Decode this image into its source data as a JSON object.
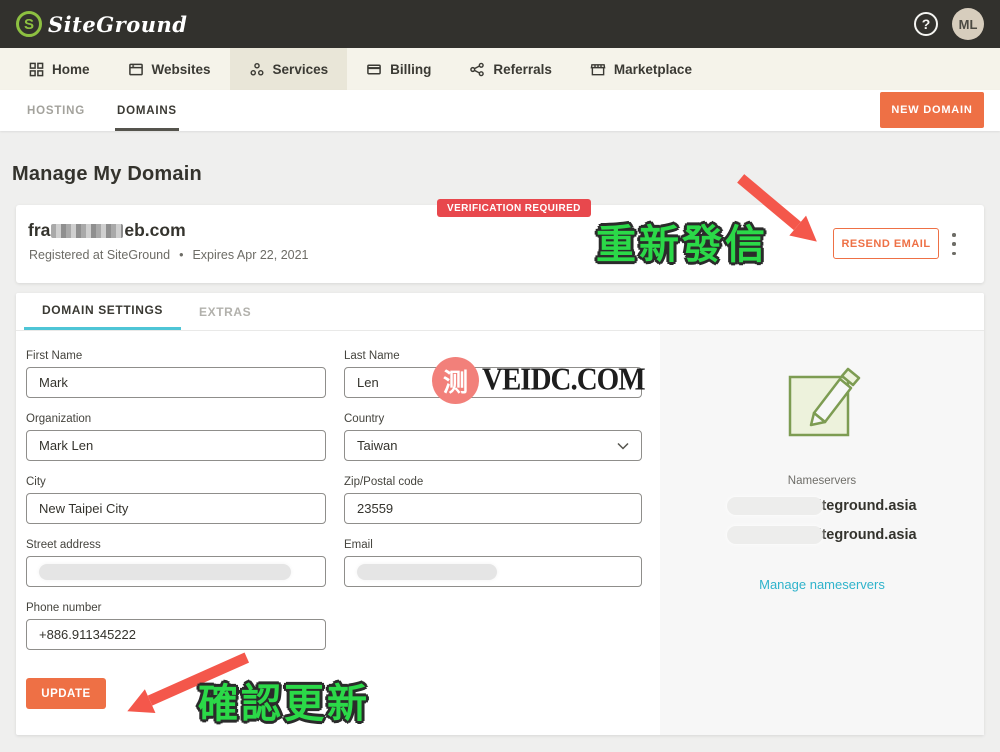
{
  "header": {
    "brand": "SiteGround",
    "brand_initial": "S",
    "help": "?",
    "avatar_initials": "ML"
  },
  "nav": {
    "items": [
      {
        "label": "Home"
      },
      {
        "label": "Websites"
      },
      {
        "label": "Services"
      },
      {
        "label": "Billing"
      },
      {
        "label": "Referrals"
      },
      {
        "label": "Marketplace"
      }
    ],
    "active": "Services"
  },
  "subtabs": {
    "hosting": "HOSTING",
    "domains": "DOMAINS",
    "new_domain_button": "NEW DOMAIN"
  },
  "page_title": "Manage My Domain",
  "domain_card": {
    "badge": "VERIFICATION REQUIRED",
    "domain_prefix": "fra",
    "domain_suffix": "eb.com",
    "registered": "Registered at SiteGround",
    "separator": "•",
    "expires": "Expires Apr 22, 2021",
    "annotation": "重新發信",
    "resend_button": "RESEND EMAIL"
  },
  "panel": {
    "tabs": {
      "settings": "DOMAIN SETTINGS",
      "extras": "EXTRAS"
    },
    "form": {
      "fields": [
        {
          "label": "First Name",
          "value": "Mark"
        },
        {
          "label": "Last Name",
          "value": "Len"
        },
        {
          "label": "Organization",
          "value": "Mark Len"
        },
        {
          "label": "Country",
          "value": "Taiwan"
        },
        {
          "label": "City",
          "value": "New Taipei City"
        },
        {
          "label": "Zip/Postal code",
          "value": "23559"
        },
        {
          "label": "Street address",
          "value": "",
          "redacted": true
        },
        {
          "label": "Email",
          "value": "",
          "redacted": true
        },
        {
          "label": "Phone number",
          "value": "+886.911345222"
        }
      ]
    },
    "update_button": "UPDATE",
    "annotation": "確認更新"
  },
  "sidebar": {
    "nameservers_label": "Nameservers",
    "nameservers": [
      {
        "visible_suffix": "iteground.asia"
      },
      {
        "visible_suffix": "iteground.asia"
      }
    ],
    "manage_link": "Manage nameservers"
  },
  "watermark": {
    "cjk": "测",
    "text": "VEIDC.COM"
  },
  "colors": {
    "accent_orange": "#ee7045",
    "badge_red": "#e8484d",
    "tab_teal": "#4ec5d6",
    "link_teal": "#2fb3cb",
    "annotation_green": "#2bd948",
    "arrow_red": "#f4574b",
    "header_dark": "#32312d",
    "nav_beige": "#f5f3ea",
    "logo_green": "#8dc041",
    "note_icon_green": "#7d9c52"
  }
}
